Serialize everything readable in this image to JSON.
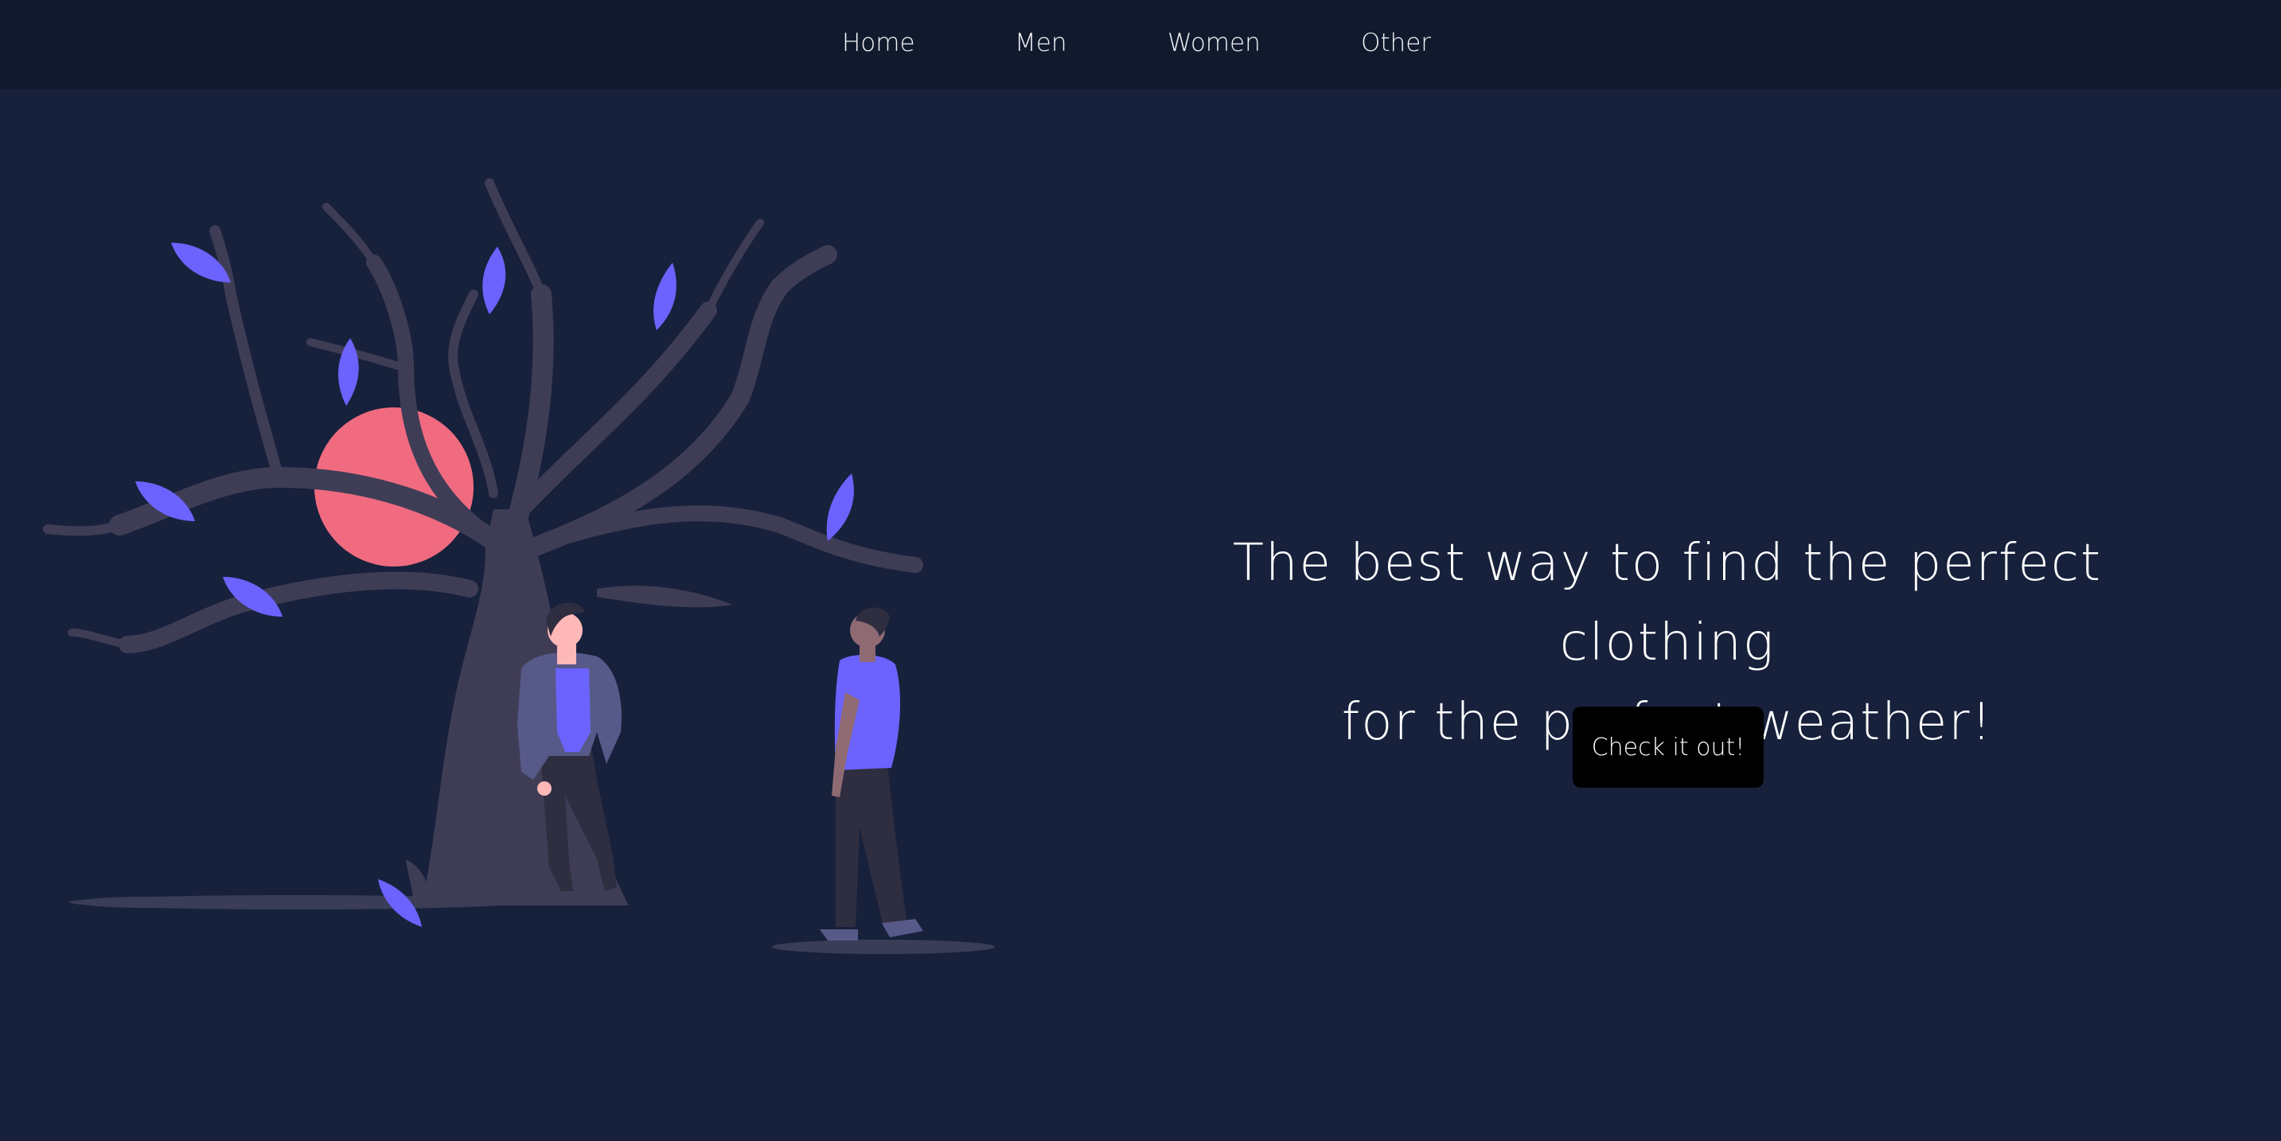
{
  "nav": {
    "items": [
      {
        "label": "Home"
      },
      {
        "label": "Men"
      },
      {
        "label": "Women"
      },
      {
        "label": "Other"
      }
    ]
  },
  "hero": {
    "headline_line1": "The best way to find the perfect clothing",
    "headline_line2": "for the perfect weather!",
    "cta_label": "Check it out!"
  },
  "colors": {
    "page_background": "#17213c",
    "navbar_background": "#111a2d",
    "text": "#ffffff",
    "button_background": "#000000",
    "illustration_accent": "#6c63ff",
    "illustration_sun": "#f06b80",
    "illustration_tree": "#3f3d56"
  },
  "illustration": {
    "icon": "people-under-tree-illustration"
  }
}
